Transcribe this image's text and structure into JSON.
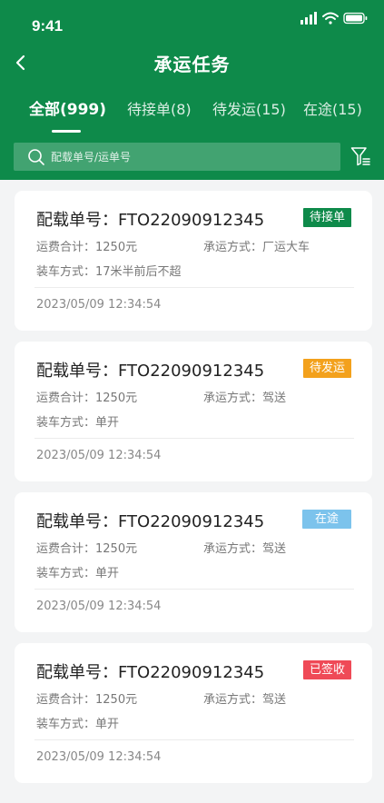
{
  "status": {
    "time": "9:41"
  },
  "nav": {
    "title": "承运任务"
  },
  "tabs": [
    {
      "label": "全部(999)"
    },
    {
      "label": "待接单(8)"
    },
    {
      "label": "待发运(15)"
    },
    {
      "label": "在途(15)"
    }
  ],
  "search": {
    "placeholder": "配载单号/运单号"
  },
  "orders": [
    {
      "title": "配载单号：FTO22090912345",
      "status": "待接单",
      "status_color": "#0e8a4a",
      "fee": "运费合计：1250元",
      "mode": "承运方式：厂运大车",
      "loading": "装车方式：17米半前后不超",
      "time": "2023/05/09 12:34:54"
    },
    {
      "title": "配载单号：FTO22090912345",
      "status": "待发运",
      "status_color": "#f3a11c",
      "fee": "运费合计：1250元",
      "mode": "承运方式：驾送",
      "loading": "装车方式：单开",
      "time": "2023/05/09 12:34:54"
    },
    {
      "title": "配载单号：FTO22090912345",
      "status": "在途",
      "status_color": "#7cc3ec",
      "fee": "运费合计：1250元",
      "mode": "承运方式：驾送",
      "loading": "装车方式：单开",
      "time": "2023/05/09 12:34:54"
    },
    {
      "title": "配载单号：FTO22090912345",
      "status": "已签收",
      "status_color": "#ef4a57",
      "fee": "运费合计：1250元",
      "mode": "承运方式：驾送",
      "loading": "装车方式：单开",
      "time": "2023/05/09 12:34:54"
    }
  ]
}
